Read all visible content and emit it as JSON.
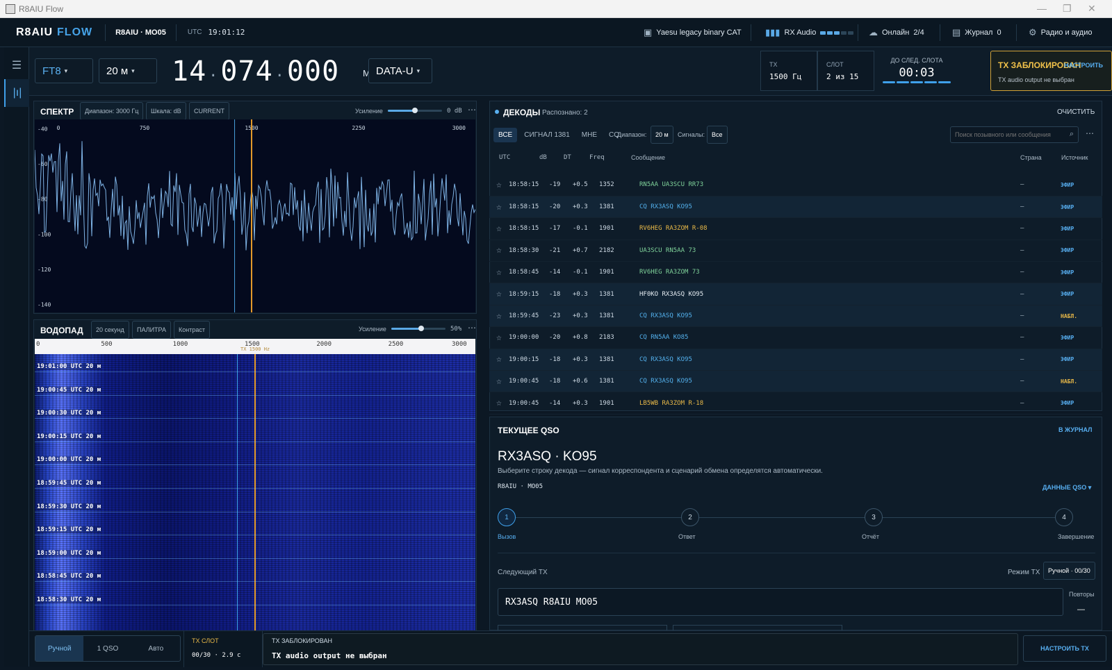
{
  "window": {
    "title": "R8AIU Flow"
  },
  "header": {
    "brand1": "R8AIU",
    "brand2": "FLOW",
    "station": "R8AIU · MO05",
    "utc_label": "UTC",
    "utc_time": "19:01:12",
    "cat": "Yaesu legacy binary CAT",
    "rx_audio": "RX Audio",
    "rx_level": 0.6,
    "online": "Онлайн",
    "online_count": "2/4",
    "journal": "Журнал",
    "journal_count": "0",
    "radio_audio": "Радио и аудио"
  },
  "controls": {
    "mode": "FT8",
    "band": "20 м",
    "freq": [
      "14",
      "074",
      "000"
    ],
    "freq_unit": "МГц",
    "submode": "DATA-U",
    "tx_label": "TX",
    "tx_value": "1500 Гц",
    "slot_label": "СЛОТ",
    "slot_value": "2 из 15",
    "next_label": "ДО СЛЕД. СЛОТА",
    "next_value": "00:03",
    "lock_title": "TX ЗАБЛОКИРОВАН",
    "lock_sub": "TX audio output не выбран",
    "lock_cfg": "НАСТРОИТЬ"
  },
  "spectrum": {
    "title": "СПЕКТР",
    "range": "Диапазон: 3000 Гц",
    "scale": "Шкала: dB",
    "current": "CURRENT",
    "gain_label": "Усиление",
    "gain_value": "0 dB",
    "gain_level": 0.5,
    "x_ticks": [
      "0",
      "750",
      "1500",
      "2250",
      "3000"
    ],
    "y_ticks": [
      "-40",
      "-60",
      "-80",
      "-100",
      "-120",
      "-140"
    ],
    "ylim": [
      -145,
      -35
    ],
    "xlim": [
      0,
      3000
    ],
    "tx_freq": 1500,
    "rx_freq": 1381
  },
  "waterfall": {
    "title": "ВОДОПАД",
    "duration": "20 секунд",
    "palette": "ПАЛИТРА",
    "contrast": "Контраст",
    "gain_label": "Усиление",
    "gain_value": "50%",
    "gain_level": 0.55,
    "x_ticks": [
      "0",
      "500",
      "1000",
      "1500",
      "2000",
      "2500",
      "3000"
    ],
    "tx_label": "TX 1500 Hz",
    "rows": [
      "19:01:00 UTC  20 м",
      "19:00:45 UTC  20 м",
      "19:00:30 UTC  20 м",
      "19:00:15 UTC  20 м",
      "19:00:00 UTC  20 м",
      "18:59:45 UTC  20 м",
      "18:59:30 UTC  20 м",
      "18:59:15 UTC  20 м",
      "18:59:00 UTC  20 м",
      "18:58:45 UTC  20 м",
      "18:58:30 UTC  20 м"
    ]
  },
  "decodes": {
    "title": "ДЕКОДЫ",
    "count": "Распознано: 2",
    "clear": "ОЧИСТИТЬ",
    "tabs": [
      "ВСЕ",
      "СИГНАЛ 1381",
      "МНЕ",
      "CQ"
    ],
    "band_label": "Диапазон:",
    "band_value": "20 м",
    "signals_label": "Сигналы:",
    "signals_value": "Все",
    "search_placeholder": "Поиск позывного или сообщения",
    "columns": [
      "UTC",
      "dB",
      "DT",
      "Freq",
      "Сообщение",
      "Страна",
      "Источник"
    ],
    "rows": [
      {
        "utc": "18:58:15",
        "db": "-19",
        "dt": "+0.5",
        "freq": "1352",
        "msg": "RN5AA UA3SCU RR73",
        "country": "—",
        "src": "ЭФИР",
        "c": "#7fd29a",
        "hl": false
      },
      {
        "utc": "18:58:15",
        "db": "-20",
        "dt": "+0.3",
        "freq": "1381",
        "msg": "CQ RX3ASQ KO95",
        "country": "—",
        "src": "ЭФИР",
        "c": "#53b0ec",
        "hl": true
      },
      {
        "utc": "18:58:15",
        "db": "-17",
        "dt": "-0.1",
        "freq": "1901",
        "msg": "RV6HEG RA3ZOM R-08",
        "country": "—",
        "src": "ЭФИР",
        "c": "#e9b948",
        "hl": false
      },
      {
        "utc": "18:58:30",
        "db": "-21",
        "dt": "+0.7",
        "freq": "2182",
        "msg": "UA3SCU RN5AA 73",
        "country": "—",
        "src": "ЭФИР",
        "c": "#7fd29a",
        "hl": false
      },
      {
        "utc": "18:58:45",
        "db": "-14",
        "dt": "-0.1",
        "freq": "1901",
        "msg": "RV6HEG RA3ZOM 73",
        "country": "—",
        "src": "ЭФИР",
        "c": "#7fd29a",
        "hl": false
      },
      {
        "utc": "18:59:15",
        "db": "-18",
        "dt": "+0.3",
        "freq": "1381",
        "msg": "HF0KO RX3ASQ KO95",
        "country": "—",
        "src": "ЭФИР",
        "c": "#e6edf3",
        "hl": true
      },
      {
        "utc": "18:59:45",
        "db": "-23",
        "dt": "+0.3",
        "freq": "1381",
        "msg": "CQ RX3ASQ KO95",
        "country": "—",
        "src": "НАБЛ.",
        "c": "#53b0ec",
        "hl": true
      },
      {
        "utc": "19:00:00",
        "db": "-20",
        "dt": "+0.8",
        "freq": "2183",
        "msg": "CQ RN5AA KO85",
        "country": "—",
        "src": "ЭФИР",
        "c": "#53b0ec",
        "hl": false
      },
      {
        "utc": "19:00:15",
        "db": "-18",
        "dt": "+0.3",
        "freq": "1381",
        "msg": "CQ RX3ASQ KO95",
        "country": "—",
        "src": "ЭФИР",
        "c": "#53b0ec",
        "hl": true
      },
      {
        "utc": "19:00:45",
        "db": "-18",
        "dt": "+0.6",
        "freq": "1381",
        "msg": "CQ RX3ASQ KO95",
        "country": "—",
        "src": "НАБЛ.",
        "c": "#53b0ec",
        "hl": true
      },
      {
        "utc": "19:00:45",
        "db": "-14",
        "dt": "+0.3",
        "freq": "1901",
        "msg": "LB5WB RA3ZOM R-18",
        "country": "—",
        "src": "ЭФИР",
        "c": "#e9b948",
        "hl": false
      }
    ]
  },
  "qso": {
    "title": "ТЕКУЩЕЕ QSO",
    "to_journal": "В ЖУРНАЛ",
    "call": "RX3ASQ · KO95",
    "hint": "Выберите строку декода — сигнал корреспондента и сценарий обмена определятся автоматически.",
    "my": "R8AIU · MO05",
    "data_btn": "ДАННЫЕ QSO",
    "steps": [
      {
        "n": "1",
        "label": "Вызов"
      },
      {
        "n": "2",
        "label": "Ответ"
      },
      {
        "n": "3",
        "label": "Отчёт"
      },
      {
        "n": "4",
        "label": "Завершение"
      }
    ],
    "next_tx_label": "Следующий TX",
    "tx_mode_label": "Режим TX",
    "tx_mode_value": "Ручной · 00/30",
    "next_tx_msg": "RX3ASQ R8AIU MO05",
    "repeats_label": "Повторы",
    "repeats_value": "—"
  },
  "bottom": {
    "modes": [
      "Ручной",
      "1 QSO",
      "Авто"
    ],
    "slot_label": "TX СЛОТ",
    "slot_value": "00/30 · 2.9 с",
    "lock_label": "TX ЗАБЛОКИРОВАН",
    "lock_msg": "TX audio output не выбран",
    "cfg_btn": "НАСТРОИТЬ TX"
  }
}
